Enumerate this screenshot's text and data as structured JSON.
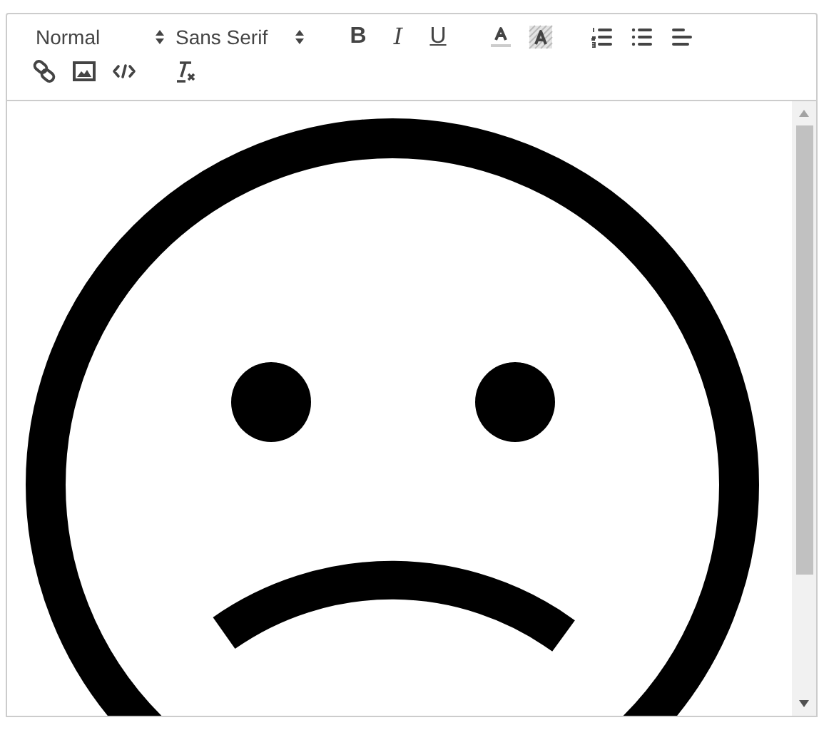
{
  "toolbar": {
    "pickers": [
      {
        "kind": "header",
        "value": "Normal"
      },
      {
        "kind": "font",
        "value": "Sans Serif"
      }
    ],
    "format_buttons": [
      {
        "kind": "bold",
        "label": "B"
      },
      {
        "kind": "italic",
        "label": "I"
      },
      {
        "kind": "underline",
        "label": "U"
      }
    ]
  },
  "editor": {
    "content": {
      "kind": "sad-face"
    }
  }
}
